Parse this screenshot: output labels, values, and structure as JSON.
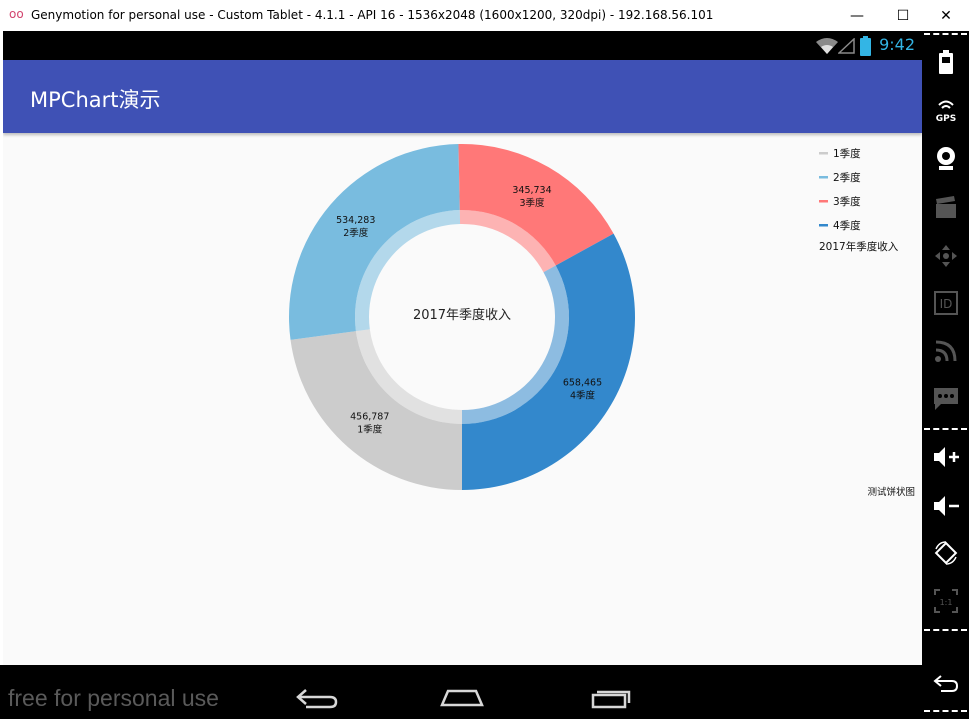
{
  "window": {
    "title": "Genymotion for personal use - Custom Tablet - 4.1.1 - API 16 - 1536x2048 (1600x1200, 320dpi) - 192.168.56.101",
    "logo_text": "oo",
    "minimize": "—",
    "maximize": "☐",
    "close": "✕"
  },
  "status_bar": {
    "time": "9:42"
  },
  "app_bar": {
    "title": "MPChart演示"
  },
  "chart_data": {
    "type": "pie",
    "variant": "donut",
    "center_text": "2017年季度收入",
    "description": "测试饼状图",
    "legend_position": "top-right",
    "legend_label": "2017年季度收入",
    "categories": [
      "1季度",
      "2季度",
      "3季度",
      "4季度"
    ],
    "values": [
      456787,
      534283,
      345734,
      658465
    ],
    "value_labels": [
      "456,787",
      "534,283",
      "345,734",
      "658,465"
    ],
    "colors": [
      "#cccccc",
      "#79bcdf",
      "#ff7878",
      "#3388cc"
    ],
    "start_direction": "bottom, clockwise"
  },
  "nav_bar": {
    "watermark": "free for personal use",
    "back": "back",
    "home": "home",
    "recents": "recent apps"
  },
  "side_panel": {
    "icons": [
      "battery-icon",
      "gps-icon",
      "camera-icon",
      "video-icon",
      "dpad-icon",
      "id-icon",
      "rss-icon",
      "sms-icon",
      "volume-up-icon",
      "volume-down-icon",
      "rotate-icon",
      "pixel-perfect-icon",
      "back-icon"
    ],
    "gps_label": "GPS",
    "id_label": "ID",
    "scale_label": "1:1"
  }
}
